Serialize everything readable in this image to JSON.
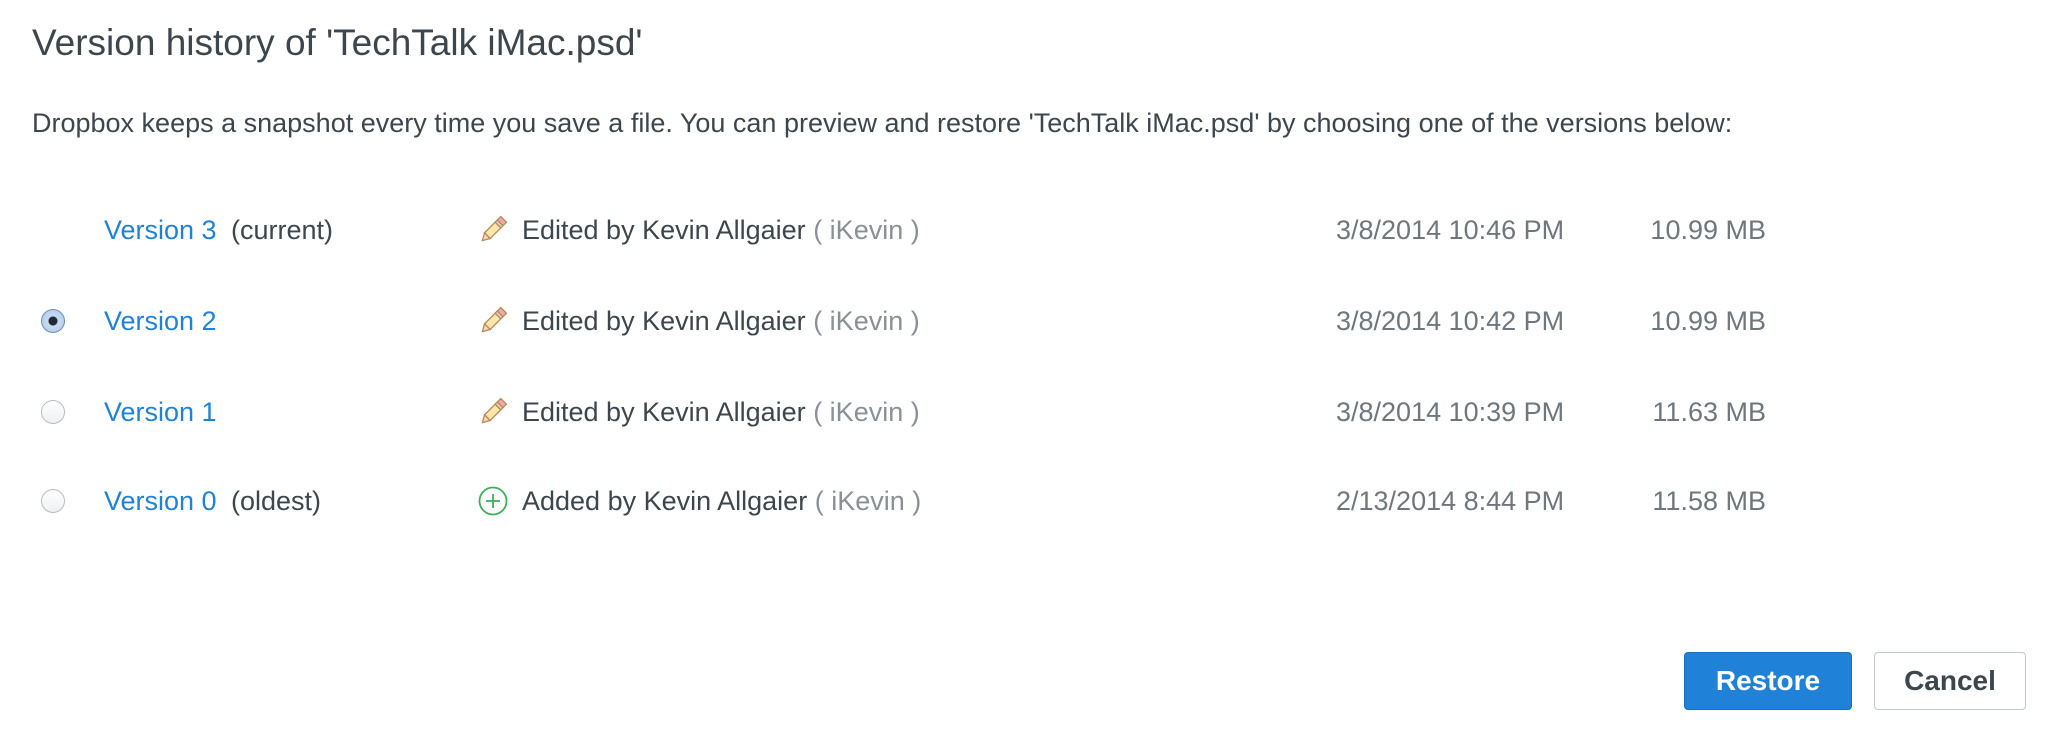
{
  "dialog": {
    "title": "Version history of 'TechTalk iMac.psd'",
    "description": "Dropbox keeps a snapshot every time you save a file. You can preview and restore 'TechTalk iMac.psd' by choosing one of the versions below:"
  },
  "versions": [
    {
      "label": "Version 3",
      "note": "(current)",
      "radio": "none",
      "action_icon": "pencil-icon",
      "action": "Edited by Kevin Allgaier",
      "username": "( iKevin )",
      "date": "3/8/2014 10:46 PM",
      "size": "10.99 MB"
    },
    {
      "label": "Version 2",
      "note": "",
      "radio": "checked",
      "action_icon": "pencil-icon",
      "action": "Edited by Kevin Allgaier",
      "username": "( iKevin )",
      "date": "3/8/2014 10:42 PM",
      "size": "10.99 MB"
    },
    {
      "label": "Version 1",
      "note": "",
      "radio": "unchecked",
      "action_icon": "pencil-icon",
      "action": "Edited by Kevin Allgaier",
      "username": "( iKevin )",
      "date": "3/8/2014 10:39 PM",
      "size": "11.63 MB"
    },
    {
      "label": "Version 0",
      "note": "(oldest)",
      "radio": "unchecked",
      "action_icon": "plus-circle-icon",
      "action": "Added by Kevin Allgaier",
      "username": "( iKevin )",
      "date": "2/13/2014 8:44 PM",
      "size": "11.58 MB"
    }
  ],
  "buttons": {
    "restore_label": "Restore",
    "cancel_label": "Cancel"
  },
  "colors": {
    "link": "#1f82d8",
    "primary_button": "#1f82d8",
    "text": "#3d464d",
    "muted": "#6f767c",
    "added_icon": "#3fae5a"
  }
}
